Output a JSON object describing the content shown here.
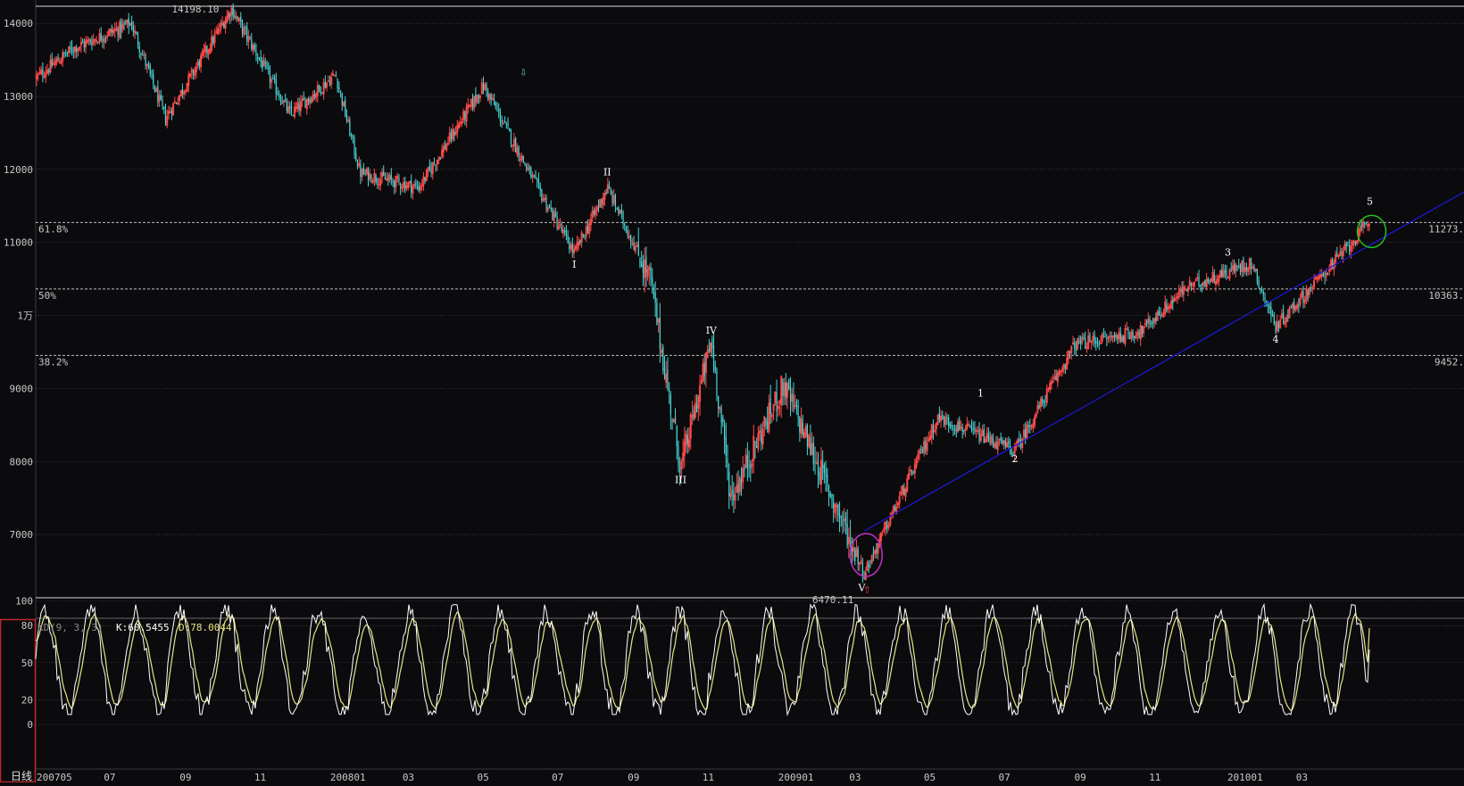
{
  "price_axis": {
    "labels": [
      "14000",
      "13000",
      "12000",
      "11000",
      "1万",
      "9000",
      "8000",
      "7000"
    ]
  },
  "kd_axis": {
    "labels": [
      "100",
      "80",
      "50",
      "20",
      "0"
    ]
  },
  "date_axis": {
    "labels": [
      "200705",
      "07",
      "09",
      "11",
      "200801",
      "03",
      "05",
      "07",
      "09",
      "11",
      "200901",
      "03",
      "05",
      "07",
      "09",
      "11",
      "201001",
      "03"
    ]
  },
  "period_tab": "日线",
  "kd_legend": {
    "name": "KD",
    "params": "(9, 3, 3)",
    "k_text": "K:60.5455",
    "d_text": "D:78.0044"
  },
  "extremes": {
    "high_label": "14198.10",
    "low_label": "6470.11"
  },
  "fib_levels": [
    {
      "pct": "61.8%",
      "value_text": "11273."
    },
    {
      "pct": "50%",
      "value_text": "10363."
    },
    {
      "pct": "38.2%",
      "value_text": "9452."
    }
  ],
  "wave_labels": [
    "I",
    "II",
    "III",
    "IV",
    "V",
    "1",
    "2",
    "3",
    "4",
    "5"
  ],
  "colors": {
    "up": "#ff4a4a",
    "down": "#47d7d7",
    "k_line": "#ffffff",
    "d_line": "#e6e680",
    "trendline": "#1a1ad6",
    "circle_low": "#c030c0",
    "circle_high": "#20c020",
    "grid": "#555555"
  },
  "chart_data": [
    {
      "type": "line",
      "title": "",
      "xlabel": "",
      "ylabel": "",
      "ylim": [
        6300,
        14300
      ],
      "x_start": "2007-05",
      "x_end": "2010-04",
      "representation": "candlestick (daily), rendered from piecewise swing points",
      "series": [
        {
          "name": "",
          "x": [
            "2007-05-02",
            "2007-06-01",
            "2007-07-19",
            "2007-08-16",
            "2007-10-09",
            "2007-11-26",
            "2008-01-02",
            "2008-01-22",
            "2008-03-10",
            "2008-05-02",
            "2008-06-10",
            "2008-07-15",
            "2008-08-11",
            "2008-09-15",
            "2008-10-10",
            "2008-11-04",
            "2008-11-20",
            "2009-01-02",
            "2009-03-09",
            "2009-05-08",
            "2009-07-10",
            "2009-08-28",
            "2009-10-21",
            "2009-11-27",
            "2010-01-19",
            "2010-02-08",
            "2010-04-26"
          ],
          "values": [
            13250,
            13650,
            14000,
            12700,
            14198,
            12750,
            13300,
            11950,
            11750,
            13150,
            11900,
            10850,
            11750,
            10500,
            7900,
            9650,
            7500,
            9050,
            6470,
            8600,
            8150,
            9600,
            9780,
            10380,
            10720,
            9850,
            11273
          ]
        }
      ],
      "fibonacci": [
        {
          "level": "61.8%",
          "value": 11273
        },
        {
          "level": "50%",
          "value": 10363
        },
        {
          "level": "38.2%",
          "value": 9452
        }
      ],
      "annotations": [
        "14198.10",
        "6470.11",
        "I",
        "II",
        "III",
        "IV",
        "V",
        "1",
        "2",
        "3",
        "4",
        "5"
      ],
      "trendline": [
        {
          "x": "2009-03-09",
          "y": 7050
        },
        {
          "x": "2010-04-30",
          "y": 11000
        }
      ]
    },
    {
      "type": "line",
      "title": "KD",
      "ylim": [
        -10,
        105
      ],
      "series": [
        {
          "name": "K",
          "last": 60.5455
        },
        {
          "name": "D",
          "last": 78.0044
        }
      ]
    }
  ]
}
